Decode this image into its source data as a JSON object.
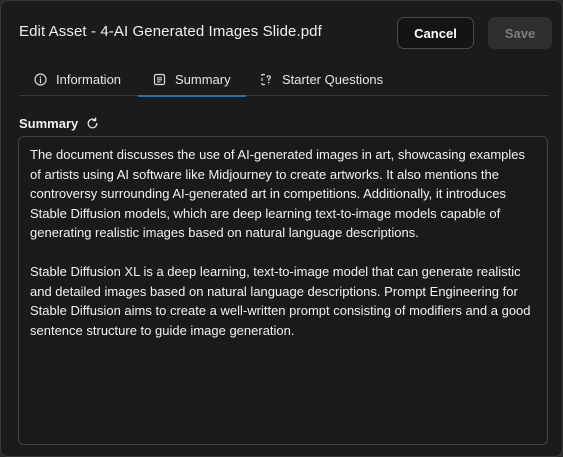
{
  "dialog": {
    "title": "Edit Asset - 4-AI Generated Images Slide.pdf",
    "cancel_label": "Cancel",
    "save_label": "Save"
  },
  "tabs": [
    {
      "label": "Information",
      "icon": "info-circle-icon",
      "active": false
    },
    {
      "label": "Summary",
      "icon": "document-lines-icon",
      "active": true
    },
    {
      "label": "Starter Questions",
      "icon": "question-flow-icon",
      "active": false
    }
  ],
  "summary": {
    "label": "Summary",
    "refresh_icon": "refresh-icon",
    "paragraphs": [
      "The document discusses the use of AI-generated images in art, showcasing examples of artists using AI software like Midjourney to create artworks. It also mentions the controversy surrounding AI-generated art in competitions. Additionally, it introduces Stable Diffusion models, which are deep learning text-to-image models capable of generating realistic images based on natural language descriptions.",
      "Stable Diffusion XL is a deep learning, text-to-image model that can generate realistic and detailed images based on natural language descriptions. Prompt Engineering for Stable Diffusion aims to create a well-written prompt consisting of modifiers and a good sentence structure to guide image generation."
    ]
  },
  "colors": {
    "background": "#1b1b1b",
    "active_tab_underline": "#2a6fb0",
    "save_disabled_bg": "#2f2f2f",
    "save_disabled_text": "#7d7d7d"
  }
}
